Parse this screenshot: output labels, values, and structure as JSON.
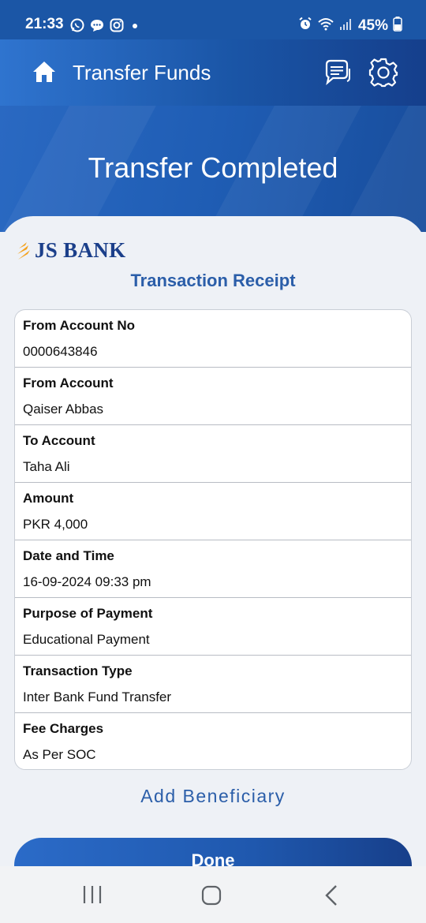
{
  "status_bar": {
    "time": "21:33",
    "battery": "45%",
    "icons": [
      "whatsapp-icon",
      "message-icon",
      "instagram-icon",
      "alarm-icon",
      "wifi-icon",
      "signal-icon",
      "battery-icon"
    ]
  },
  "header": {
    "title": "Transfer Funds",
    "icons": [
      "home-icon",
      "chat-icon",
      "gear-icon"
    ]
  },
  "hero": {
    "title": "Transfer Completed"
  },
  "bank": {
    "logo_text": "JS BANK"
  },
  "receipt": {
    "title": "Transaction Receipt",
    "rows": [
      {
        "label": "From Account No",
        "value": "0000643846"
      },
      {
        "label": "From Account",
        "value": "Qaiser Abbas"
      },
      {
        "label": "To Account",
        "value": "Taha Ali"
      },
      {
        "label": "Amount",
        "value": "PKR 4,000"
      },
      {
        "label": "Date and Time",
        "value": "16-09-2024 09:33 pm"
      },
      {
        "label": "Purpose of Payment",
        "value": "Educational Payment"
      },
      {
        "label": "Transaction Type",
        "value": "Inter Bank Fund Transfer"
      },
      {
        "label": "Fee Charges",
        "value": "As Per SOC"
      }
    ]
  },
  "actions": {
    "add_beneficiary": "Add Beneficiary",
    "done": "Done"
  },
  "colors": {
    "brand_blue": "#1b56a6",
    "accent_text": "#2b5ea9",
    "logo_orange": "#f4a21d"
  }
}
